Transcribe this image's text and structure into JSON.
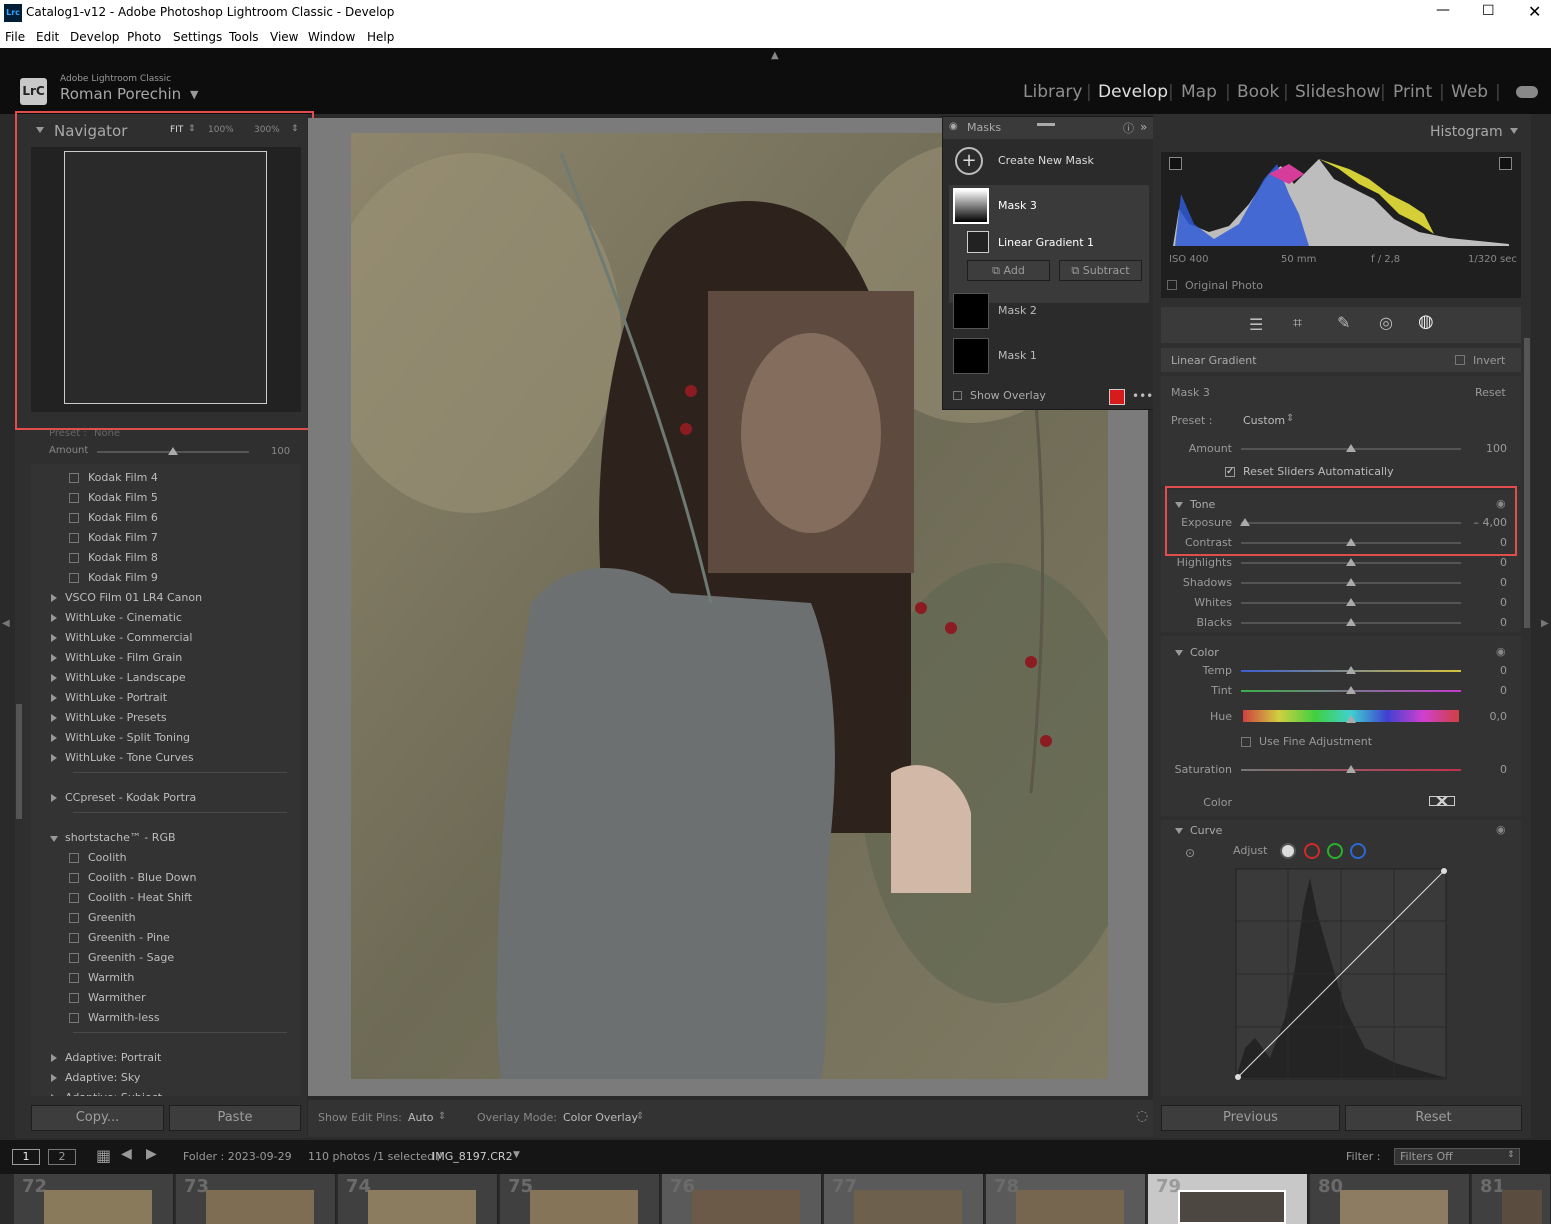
{
  "window": {
    "title": "Catalog1-v12 - Adobe Photoshop Lightroom Classic - Develop",
    "app_icon": "Lrc"
  },
  "menu": [
    "File",
    "Edit",
    "Develop",
    "Photo",
    "Settings",
    "Tools",
    "View",
    "Window",
    "Help"
  ],
  "identity": {
    "logo": "LrC",
    "product": "Adobe Lightroom Classic",
    "user": "Roman Porechin"
  },
  "modules": [
    "Library",
    "Develop",
    "Map",
    "Book",
    "Slideshow",
    "Print",
    "Web"
  ],
  "active_module": "Develop",
  "navigator": {
    "title": "Navigator",
    "zoom": [
      "FIT",
      "100%",
      "300%"
    ]
  },
  "preset_strip": {
    "preset_label": "Preset :",
    "preset_value": "None",
    "amount_label": "Amount",
    "amount_value": "100"
  },
  "presets": [
    {
      "type": "item",
      "label": "Kodak Film 4"
    },
    {
      "type": "item",
      "label": "Kodak Film 5"
    },
    {
      "type": "item",
      "label": "Kodak Film 6"
    },
    {
      "type": "item",
      "label": "Kodak Film 7"
    },
    {
      "type": "item",
      "label": "Kodak Film 8"
    },
    {
      "type": "item",
      "label": "Kodak Film 9"
    },
    {
      "type": "group",
      "label": "VSCO Film 01 LR4 Canon"
    },
    {
      "type": "group",
      "label": "WithLuke - Cinematic"
    },
    {
      "type": "group",
      "label": "WithLuke - Commercial"
    },
    {
      "type": "group",
      "label": "WithLuke - Film Grain"
    },
    {
      "type": "group",
      "label": "WithLuke - Landscape"
    },
    {
      "type": "group",
      "label": "WithLuke - Portrait"
    },
    {
      "type": "group",
      "label": "WithLuke - Presets"
    },
    {
      "type": "group",
      "label": "WithLuke - Split Toning"
    },
    {
      "type": "group",
      "label": "WithLuke - Tone Curves"
    },
    {
      "type": "sep"
    },
    {
      "type": "group",
      "label": "CCpreset - Kodak Portra"
    },
    {
      "type": "sep"
    },
    {
      "type": "open",
      "label": "shortstache™ - RGB"
    },
    {
      "type": "item",
      "label": "Coolith"
    },
    {
      "type": "item",
      "label": "Coolith - Blue Down"
    },
    {
      "type": "item",
      "label": "Coolith - Heat Shift"
    },
    {
      "type": "item",
      "label": "Greenith"
    },
    {
      "type": "item",
      "label": "Greenith - Pine"
    },
    {
      "type": "item",
      "label": "Greenith - Sage"
    },
    {
      "type": "item",
      "label": "Warmith"
    },
    {
      "type": "item",
      "label": "Warmither"
    },
    {
      "type": "item",
      "label": "Warmith-less"
    },
    {
      "type": "sep"
    },
    {
      "type": "group",
      "label": "Adaptive: Portrait"
    },
    {
      "type": "group",
      "label": "Adaptive: Sky"
    },
    {
      "type": "group",
      "label": "Adaptive: Subject"
    }
  ],
  "left_buttons": {
    "copy": "Copy...",
    "paste": "Paste"
  },
  "toolbar": {
    "pins_label": "Show Edit Pins:",
    "pins_value": "Auto",
    "overlay_label": "Overlay Mode:",
    "overlay_value": "Color Overlay"
  },
  "masks": {
    "title": "Masks",
    "create": "Create New Mask",
    "items": [
      "Mask 3",
      "Mask 2",
      "Mask 1"
    ],
    "component": "Linear Gradient 1",
    "add": "Add",
    "subtract": "Subtract",
    "show_overlay": "Show Overlay",
    "overlay_color": "#d71a1a"
  },
  "histogram": {
    "title": "Histogram",
    "iso": "ISO 400",
    "focal": "50 mm",
    "aperture": "f / 2,8",
    "shutter": "1/320 sec",
    "original": "Original Photo"
  },
  "mask_panel": {
    "type": "Linear Gradient",
    "invert": "Invert",
    "mask_name": "Mask 3",
    "reset": "Reset",
    "preset_label": "Preset :",
    "preset_value": "Custom",
    "amount_label": "Amount",
    "amount_value": "100",
    "reset_auto": "Reset Sliders Automatically"
  },
  "tone": {
    "title": "Tone",
    "sliders": [
      {
        "label": "Exposure",
        "value": "– 4,00",
        "pos": 0.02
      },
      {
        "label": "Contrast",
        "value": "0",
        "pos": 0.5
      },
      {
        "label": "Highlights",
        "value": "0",
        "pos": 0.5
      },
      {
        "label": "Shadows",
        "value": "0",
        "pos": 0.5
      },
      {
        "label": "Whites",
        "value": "0",
        "pos": 0.5
      },
      {
        "label": "Blacks",
        "value": "0",
        "pos": 0.5
      }
    ]
  },
  "color": {
    "title": "Color",
    "temp_label": "Temp",
    "temp_value": "0",
    "tint_label": "Tint",
    "tint_value": "0",
    "hue_label": "Hue",
    "hue_value": "0,0",
    "fine": "Use Fine Adjustment",
    "sat_label": "Saturation",
    "sat_value": "0",
    "color_label": "Color"
  },
  "curve": {
    "title": "Curve",
    "adjust": "Adjust"
  },
  "right_buttons": {
    "previous": "Previous",
    "reset": "Reset"
  },
  "filmstrip": {
    "page1": "1",
    "page2": "2",
    "folder": "Folder : 2023-09-29",
    "count": "110 photos /1 selected /",
    "file": "IMG_8197.CR2",
    "filter_label": "Filter :",
    "filter_value": "Filters Off",
    "frames": [
      "72",
      "73",
      "74",
      "75",
      "76",
      "77",
      "78",
      "79",
      "80",
      "81"
    ]
  }
}
